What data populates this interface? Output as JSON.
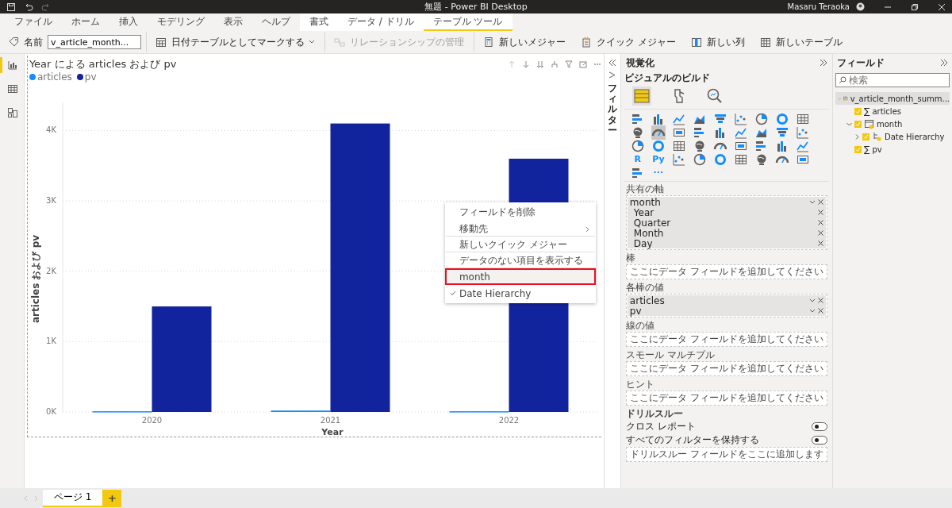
{
  "window": {
    "title": "無題 - Power BI Desktop",
    "user": "Masaru Teraoka"
  },
  "ribbon_tabs": [
    {
      "label": "ファイル",
      "kind": "plain",
      "selected": false
    },
    {
      "label": "ホーム",
      "kind": "plain",
      "selected": false
    },
    {
      "label": "挿入",
      "kind": "plain",
      "selected": false
    },
    {
      "label": "モデリング",
      "kind": "plain",
      "selected": false
    },
    {
      "label": "表示",
      "kind": "plain",
      "selected": false
    },
    {
      "label": "ヘルプ",
      "kind": "plain",
      "selected": false
    },
    {
      "label": "書式",
      "kind": "contextual",
      "selected": false
    },
    {
      "label": "データ / ドリル",
      "kind": "contextual",
      "selected": false
    },
    {
      "label": "テーブル ツール",
      "kind": "contextual",
      "selected": true
    }
  ],
  "toolbar": {
    "name_label": "名前",
    "name_value": "v_article_month...",
    "buttons": [
      {
        "label": "日付テーブルとしてマークする",
        "disabled": false,
        "dropdown": true
      },
      {
        "label": "リレーションシップの管理",
        "disabled": true,
        "dropdown": false
      },
      {
        "label": "新しいメジャー",
        "disabled": false,
        "dropdown": false
      },
      {
        "label": "クイック メジャー",
        "disabled": false,
        "dropdown": false
      },
      {
        "label": "新しい列",
        "disabled": false,
        "dropdown": false
      },
      {
        "label": "新しいテーブル",
        "disabled": false,
        "dropdown": false
      }
    ]
  },
  "left_rail": [
    {
      "kind": "report",
      "selected": true
    },
    {
      "kind": "data",
      "selected": false
    },
    {
      "kind": "model",
      "selected": false
    }
  ],
  "visual": {
    "chart_data": {
      "type": "bar",
      "title": "Year による articles および pv",
      "xlabel": "Year",
      "ylabel": "articles および pv",
      "categories": [
        "2020",
        "2021",
        "2022"
      ],
      "series": [
        {
          "name": "articles",
          "color": "#118dff",
          "values": [
            10,
            20,
            10
          ]
        },
        {
          "name": "pv",
          "color": "#12239e",
          "values": [
            1500,
            4100,
            3600
          ]
        }
      ],
      "grid": true,
      "ylim": [
        0,
        4400
      ],
      "yticks": [
        {
          "value": 0,
          "label": "0K"
        },
        {
          "value": 1000,
          "label": "1K"
        },
        {
          "value": 2000,
          "label": "2K"
        },
        {
          "value": 3000,
          "label": "3K"
        },
        {
          "value": 4000,
          "label": "4K"
        }
      ]
    }
  },
  "context_menu": {
    "items": [
      {
        "label": "フィールドを削除",
        "submenu": false,
        "checked": false,
        "highlighted": false,
        "separator_after": false
      },
      {
        "label": "移動先",
        "submenu": true,
        "checked": false,
        "highlighted": false,
        "separator_after": true
      },
      {
        "label": "新しいクイック メジャー",
        "submenu": false,
        "checked": false,
        "highlighted": false,
        "separator_after": true
      },
      {
        "label": "データのない項目を表示する",
        "submenu": false,
        "checked": false,
        "highlighted": false,
        "separator_after": true
      },
      {
        "label": "month",
        "submenu": false,
        "checked": false,
        "highlighted": true,
        "separator_after": false
      },
      {
        "label": "Date Hierarchy",
        "submenu": false,
        "checked": true,
        "highlighted": false,
        "separator_after": false
      }
    ]
  },
  "filters_pane": {
    "label": "フィルター"
  },
  "visualizations": {
    "title": "視覚化",
    "subtitle": "ビジュアルのビルド",
    "modes": [
      {
        "kind": "build",
        "selected": true
      },
      {
        "kind": "format",
        "selected": false
      },
      {
        "kind": "analytics",
        "selected": false
      }
    ],
    "gallery": [
      {
        "kind": "icon",
        "selected": false
      },
      {
        "kind": "icon",
        "selected": false
      },
      {
        "kind": "icon",
        "selected": false
      },
      {
        "kind": "icon",
        "selected": false
      },
      {
        "kind": "icon",
        "selected": false
      },
      {
        "kind": "icon",
        "selected": false
      },
      {
        "kind": "icon",
        "selected": false
      },
      {
        "kind": "icon",
        "selected": false
      },
      {
        "kind": "icon",
        "selected": false
      },
      {
        "kind": "icon",
        "selected": false
      },
      {
        "kind": "icon",
        "selected": true
      },
      {
        "kind": "icon",
        "selected": false
      },
      {
        "kind": "icon",
        "selected": false
      },
      {
        "kind": "icon",
        "selected": false
      },
      {
        "kind": "icon",
        "selected": false
      },
      {
        "kind": "icon",
        "selected": false
      },
      {
        "kind": "icon",
        "selected": false
      },
      {
        "kind": "icon",
        "selected": false
      },
      {
        "kind": "icon",
        "selected": false
      },
      {
        "kind": "icon",
        "selected": false
      },
      {
        "kind": "icon",
        "selected": false
      },
      {
        "kind": "icon",
        "selected": false
      },
      {
        "kind": "icon",
        "selected": false
      },
      {
        "kind": "icon",
        "selected": false
      },
      {
        "kind": "icon",
        "selected": false
      },
      {
        "kind": "icon",
        "selected": false
      },
      {
        "kind": "icon",
        "selected": false
      },
      {
        "kind": "text",
        "label": "R",
        "selected": false
      },
      {
        "kind": "text",
        "label": "Py",
        "selected": false
      },
      {
        "kind": "icon",
        "selected": false
      },
      {
        "kind": "icon",
        "selected": false
      },
      {
        "kind": "icon",
        "selected": false
      },
      {
        "kind": "icon",
        "selected": false
      },
      {
        "kind": "icon",
        "selected": false
      },
      {
        "kind": "icon",
        "selected": false
      },
      {
        "kind": "icon",
        "selected": false
      },
      {
        "kind": "icon",
        "selected": false
      },
      {
        "kind": "text",
        "label": "···",
        "selected": false
      }
    ],
    "wells": [
      {
        "title": "共有の軸",
        "fields": [
          {
            "label": "month",
            "children": [
              {
                "label": "Year"
              },
              {
                "label": "Quarter"
              },
              {
                "label": "Month"
              },
              {
                "label": "Day"
              }
            ]
          }
        ]
      },
      {
        "title": "棒",
        "placeholder": "ここにデータ フィールドを追加してください"
      },
      {
        "title": "各棒の値",
        "fields": [
          {
            "label": "articles"
          },
          {
            "label": "pv"
          }
        ]
      },
      {
        "title": "線の値",
        "placeholder": "ここにデータ フィールドを追加してください"
      },
      {
        "title": "スモール マルチプル",
        "placeholder": "ここにデータ フィールドを追加してください"
      },
      {
        "title": "ヒント",
        "placeholder": "ここにデータ フィールドを追加してください"
      }
    ],
    "drillthrough": {
      "title": "ドリルスルー",
      "toggles": [
        {
          "label": "クロス レポート",
          "on": false
        },
        {
          "label": "すべてのフィルターを保持する",
          "on": false
        }
      ],
      "placeholder": "ドリルスルー フィールドをここに追加します"
    }
  },
  "fields": {
    "title": "フィールド",
    "search_placeholder": "検索",
    "tree": [
      {
        "label": "v_article_month_summ...",
        "kind": "table",
        "expanded": true,
        "children": [
          {
            "label": "articles",
            "kind": "measure",
            "symbol": "∑",
            "checked": true
          },
          {
            "label": "month",
            "kind": "date",
            "checked": true,
            "expanded": true,
            "children": [
              {
                "label": "Date Hierarchy",
                "kind": "hierarchy",
                "checked": true,
                "expanded": false
              }
            ]
          },
          {
            "label": "pv",
            "kind": "measure",
            "symbol": "∑",
            "checked": true
          }
        ]
      }
    ]
  },
  "page_tabs": [
    {
      "label": "ページ 1",
      "selected": true
    }
  ],
  "add_page": "+"
}
